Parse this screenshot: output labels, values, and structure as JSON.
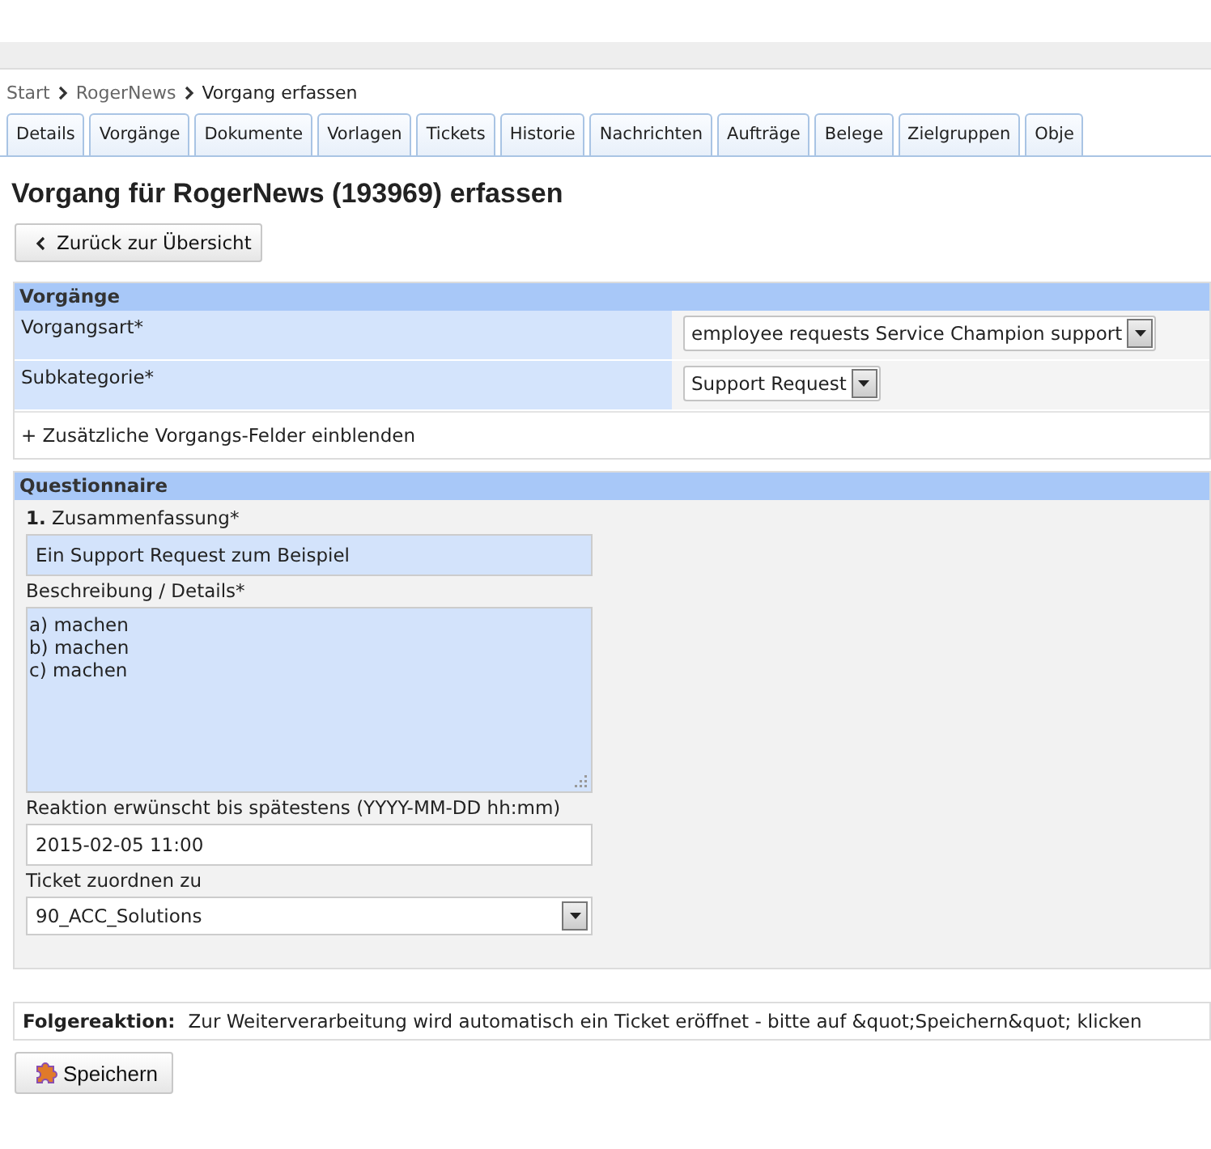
{
  "breadcrumb": [
    {
      "label": "Start",
      "kind": "link"
    },
    {
      "label": "RogerNews",
      "kind": "link"
    },
    {
      "label": "Vorgang erfassen",
      "kind": "current"
    }
  ],
  "tabs": [
    {
      "label": "Details",
      "selected": false
    },
    {
      "label": "Vorgänge",
      "selected": false
    },
    {
      "label": "Dokumente",
      "selected": false
    },
    {
      "label": "Vorlagen",
      "selected": false
    },
    {
      "label": "Tickets",
      "selected": false
    },
    {
      "label": "Historie",
      "selected": false
    },
    {
      "label": "Nachrichten",
      "selected": false
    },
    {
      "label": "Aufträge",
      "selected": false
    },
    {
      "label": "Belege",
      "selected": false
    },
    {
      "label": "Zielgruppen",
      "selected": false
    },
    {
      "label": "Obje",
      "selected": false
    }
  ],
  "page_title": "Vorgang für RogerNews (193969) erfassen",
  "back_button": "Zurück zur Übersicht",
  "vorgaenge": {
    "title": "Vorgänge",
    "fields": [
      {
        "label": "Vorgangsart*",
        "value": "employee requests Service Champion support"
      },
      {
        "label": "Subkategorie*",
        "value": "Support Request"
      }
    ],
    "toggle_link": "+ Zusätzliche Vorgangs-Felder einblenden"
  },
  "questionnaire": {
    "title": "Questionnaire",
    "fields": [
      {
        "kind": "text",
        "label": "**1.** Zusammenfassung*",
        "value": "Ein Support Request zum Beispiel",
        "highlighted": true
      },
      {
        "kind": "textarea",
        "label": "Beschreibung / Details*",
        "value": "a) machen\nb) machen\nc) machen",
        "highlighted": true
      },
      {
        "kind": "text",
        "label": "Reaktion erwünscht bis spätestens (YYYY-MM-DD hh:mm)",
        "value": "2015-02-05 11:00",
        "highlighted": false
      },
      {
        "kind": "select",
        "label": "Ticket zuordnen zu",
        "value": "90_ACC_Solutions",
        "highlighted": false
      }
    ]
  },
  "followup": {
    "label": "Folgereaktion:",
    "text": "Zur Weiterverarbeitung wird automatisch ein Ticket eröffnet - bitte auf &quot;Speichern&quot; klicken"
  },
  "save_button": "Speichern"
}
